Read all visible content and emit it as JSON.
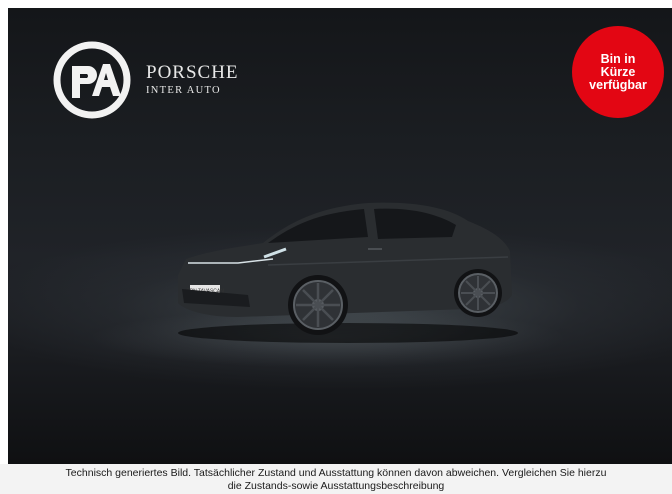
{
  "brand": {
    "name_line1": "PORSCHE",
    "name_line2": "INTER AUTO",
    "logo_icon": "pia-logo-icon"
  },
  "badge": {
    "line1": "Bin in",
    "line2": "Kürze",
    "line3": "verfügbar",
    "color": "#e30613"
  },
  "vehicle": {
    "plate_text": "CPN TAVASCAN",
    "body_color": "#2a2d30"
  },
  "disclaimer": {
    "line1": "Technisch generiertes Bild. Tatsächlicher Zustand und Ausstattung können davon abweichen. Vergleichen Sie hierzu",
    "line2": "die Zustands-sowie Ausstattungsbeschreibung"
  }
}
